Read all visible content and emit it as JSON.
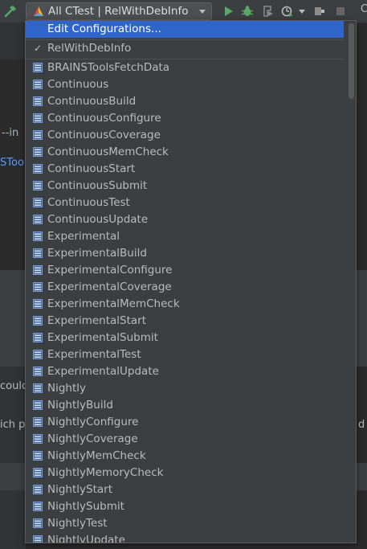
{
  "toolbar": {
    "run_config_label": "All CTest | RelWithDebInfo",
    "right_sliver_text": "C"
  },
  "background": {
    "frag_in": "--in",
    "frag_stoo": "STooi",
    "frag_could": "could",
    "frag_ich": "ich p",
    "frag_d": "d c"
  },
  "popup": {
    "edit_configurations": "Edit Configurations...",
    "checked_config": "RelWithDebInfo",
    "check_mark": "✓",
    "targets": [
      "BRAINSToolsFetchData",
      "Continuous",
      "ContinuousBuild",
      "ContinuousConfigure",
      "ContinuousCoverage",
      "ContinuousMemCheck",
      "ContinuousStart",
      "ContinuousSubmit",
      "ContinuousTest",
      "ContinuousUpdate",
      "Experimental",
      "ExperimentalBuild",
      "ExperimentalConfigure",
      "ExperimentalCoverage",
      "ExperimentalMemCheck",
      "ExperimentalStart",
      "ExperimentalSubmit",
      "ExperimentalTest",
      "ExperimentalUpdate",
      "Nightly",
      "NightlyBuild",
      "NightlyConfigure",
      "NightlyCoverage",
      "NightlyMemCheck",
      "NightlyMemoryCheck",
      "NightlyStart",
      "NightlySubmit",
      "NightlyTest",
      "NightlyUpdate"
    ]
  },
  "colors": {
    "selection": "#2f65ca",
    "popup_bg": "#3c3f41",
    "target_icon": "#6d8fbf",
    "run_green": "#59a869",
    "link_blue": "#589df6"
  },
  "icons": {
    "build": "hammer-icon",
    "cmake": "cmake-icon",
    "run": "run-icon",
    "debug": "debug-icon",
    "coverage": "coverage-icon",
    "profile": "profile-icon",
    "attach": "attach-icon",
    "stop": "stop-icon",
    "target": "target-icon"
  }
}
